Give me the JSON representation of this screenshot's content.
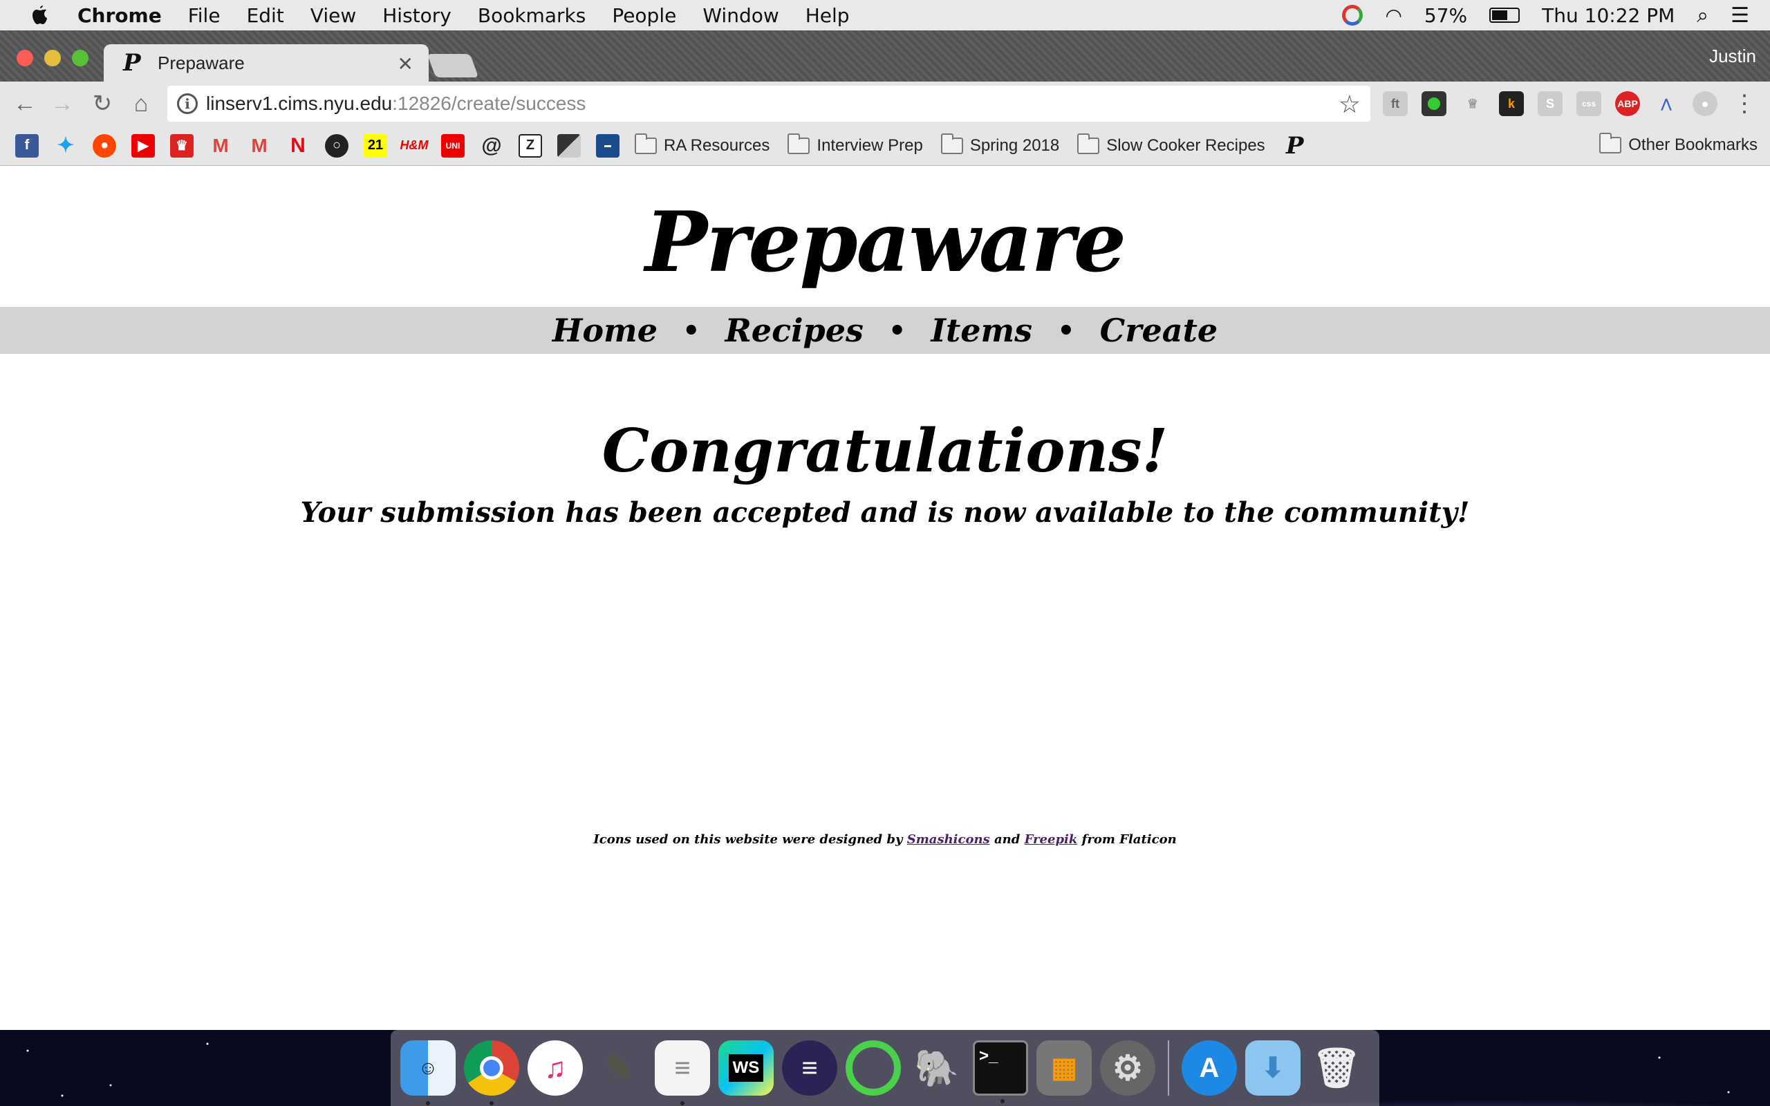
{
  "menubar": {
    "app": "Chrome",
    "items": [
      "File",
      "Edit",
      "View",
      "History",
      "Bookmarks",
      "People",
      "Window",
      "Help"
    ],
    "battery": "57%",
    "clock": "Thu 10:22 PM"
  },
  "browser": {
    "tab_title": "Prepaware",
    "profile": "Justin",
    "url_host": "linserv1.cims.nyu.edu",
    "url_path": ":12826/create/success",
    "bookmark_folders": [
      "RA Resources",
      "Interview Prep",
      "Spring 2018",
      "Slow Cooker Recipes"
    ],
    "other_bookmarks": "Other Bookmarks"
  },
  "site": {
    "title": "Prepaware",
    "nav": [
      "Home",
      "Recipes",
      "Items",
      "Create"
    ],
    "separator": "•",
    "heading": "Congratulations!",
    "message": "Your submission has been accepted and is now available to the community!",
    "footer": {
      "prefix": "Icons used on this website were designed by",
      "link1": "Smashicons",
      "and": "and",
      "link2": "Freepik",
      "suffix": "from Flaticon"
    }
  }
}
